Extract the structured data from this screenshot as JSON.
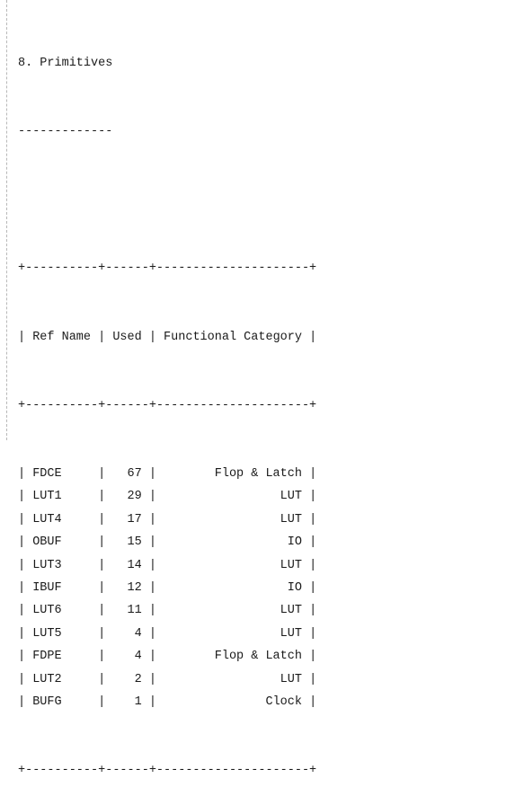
{
  "report": {
    "title": "8. Primitives",
    "underline": "-------------",
    "border": "+----------+------+---------------------+",
    "columns": [
      "Ref Name",
      "Used",
      "Functional Category"
    ],
    "rows": [
      {
        "ref_name": "FDCE",
        "used": "67",
        "category": "Flop & Latch"
      },
      {
        "ref_name": "LUT1",
        "used": "29",
        "category": "LUT"
      },
      {
        "ref_name": "LUT4",
        "used": "17",
        "category": "LUT"
      },
      {
        "ref_name": "OBUF",
        "used": "15",
        "category": "IO"
      },
      {
        "ref_name": "LUT3",
        "used": "14",
        "category": "LUT"
      },
      {
        "ref_name": "IBUF",
        "used": "12",
        "category": "IO"
      },
      {
        "ref_name": "LUT6",
        "used": "11",
        "category": "LUT"
      },
      {
        "ref_name": "LUT5",
        "used": "4",
        "category": "LUT"
      },
      {
        "ref_name": "FDPE",
        "used": "4",
        "category": "Flop & Latch"
      },
      {
        "ref_name": "LUT2",
        "used": "2",
        "category": "LUT"
      },
      {
        "ref_name": "BUFG",
        "used": "1",
        "category": "Clock"
      }
    ]
  }
}
